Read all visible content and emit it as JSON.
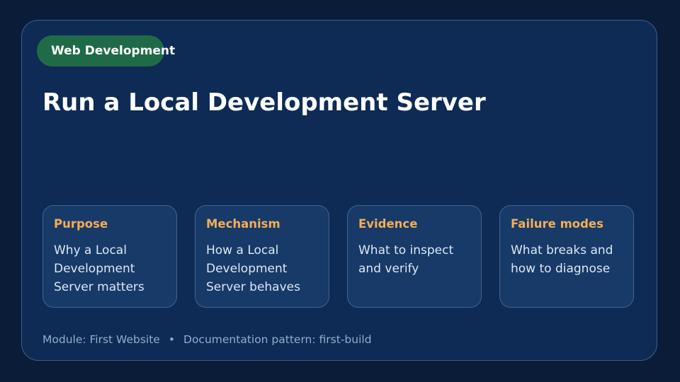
{
  "badge": {
    "label": "Web Development"
  },
  "title": "Run a Local Development Server",
  "cards": [
    {
      "title": "Purpose",
      "body": "Why a Local Development Server matters"
    },
    {
      "title": "Mechanism",
      "body": "How a Local Development Server behaves"
    },
    {
      "title": "Evidence",
      "body": "What to inspect and verify"
    },
    {
      "title": "Failure modes",
      "body": "What breaks and how to diagnose"
    }
  ],
  "footer": {
    "module": "Module: First Website",
    "separator": "•",
    "pattern": "Documentation pattern: first-build"
  },
  "colors": {
    "background": "#0a1c38",
    "panel": "#0d2b55",
    "badge": "#1f6b48",
    "card": "#173a68",
    "accent": "#f4ad55"
  }
}
